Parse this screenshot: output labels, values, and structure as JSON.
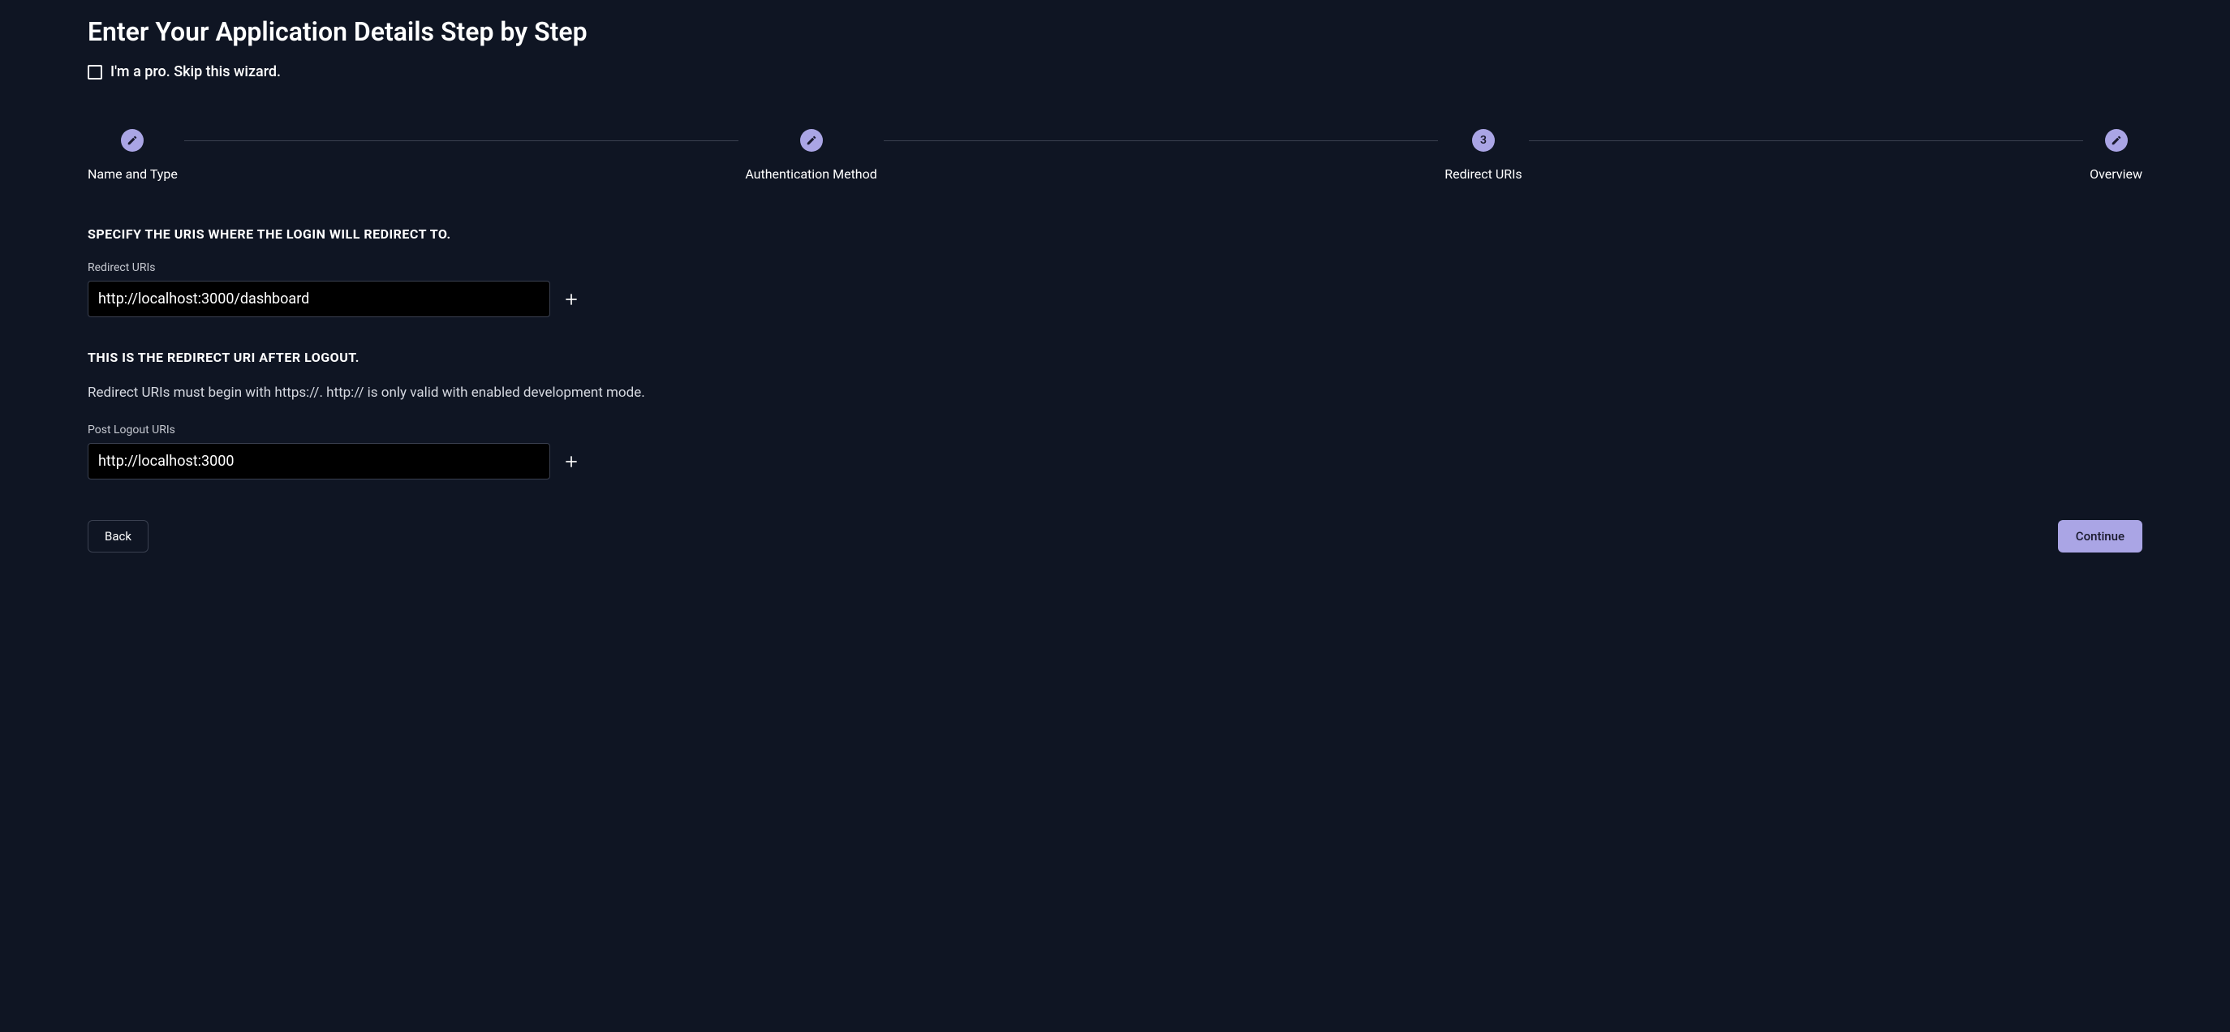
{
  "title": "Enter Your Application Details Step by Step",
  "skip": {
    "label": "I'm a pro. Skip this wizard."
  },
  "stepper": {
    "steps": [
      {
        "label": "Name and Type",
        "type": "done"
      },
      {
        "label": "Authentication Method",
        "type": "done"
      },
      {
        "label": "Redirect URIs",
        "type": "current",
        "number": "3"
      },
      {
        "label": "Overview",
        "type": "editable"
      }
    ]
  },
  "section1": {
    "heading": "SPECIFY THE URIS WHERE THE LOGIN WILL REDIRECT TO.",
    "field_label": "Redirect URIs",
    "value": "http://localhost:3000/dashboard"
  },
  "section2": {
    "heading": "THIS IS THE REDIRECT URI AFTER LOGOUT.",
    "helper": "Redirect URIs must begin with https://. http:// is only valid with enabled development mode.",
    "field_label": "Post Logout URIs",
    "value": "http://localhost:3000"
  },
  "buttons": {
    "back": "Back",
    "continue": "Continue"
  }
}
